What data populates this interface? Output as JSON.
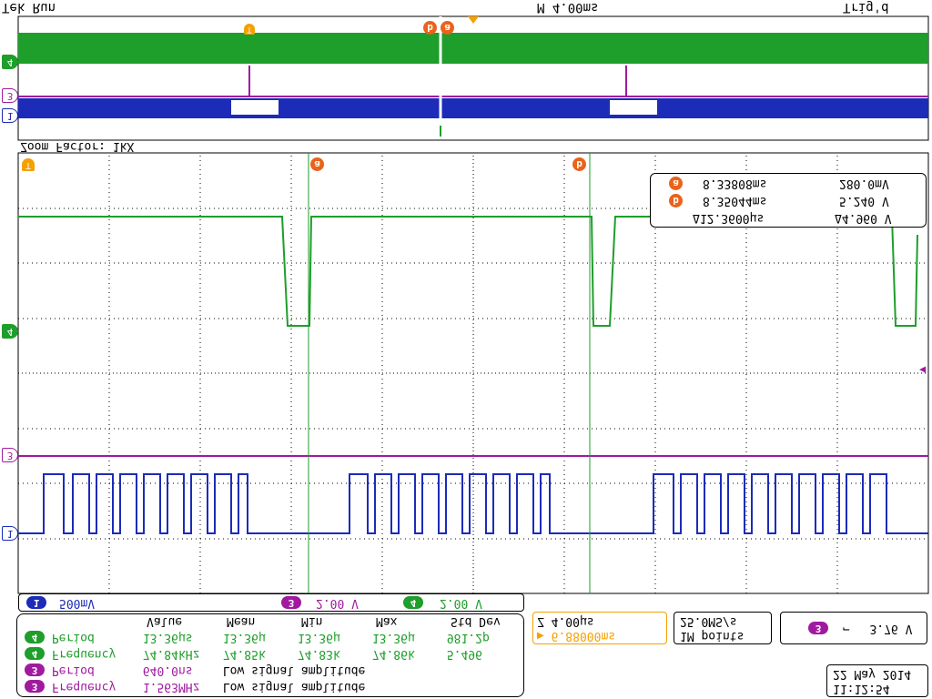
{
  "measurements": {
    "rows": [
      {
        "channel": "3",
        "name": "Frequency",
        "value": "1.563MHz",
        "mean": "Low signal amplitude",
        "min": "",
        "max": "",
        "std": ""
      },
      {
        "channel": "3",
        "name": "Period",
        "value": "640.0ns",
        "mean": "Low signal amplitude",
        "min": "",
        "max": "",
        "std": ""
      },
      {
        "channel": "4",
        "name": "Frequency",
        "value": "74.84kHz",
        "mean": "74.85k",
        "min": "74.83k",
        "max": "74.86k",
        "std": "5.496"
      },
      {
        "channel": "4",
        "name": "Period",
        "value": "13.36μs",
        "mean": "13.36μ",
        "min": "13.36μ",
        "max": "13.36μ",
        "std": "981.2p"
      }
    ],
    "headers": {
      "value": "Value",
      "mean": "Mean",
      "min": "Min",
      "max": "Max",
      "std": "Std Dev"
    }
  },
  "clock": {
    "time": "11:12:54",
    "date": "22 May 2014"
  },
  "timebase": {
    "delay": "▶ 6.88000ms",
    "scale": "Z 4.00μs"
  },
  "acquisition": {
    "points": "1M points",
    "rate": "25.0MS/s"
  },
  "trigger_info": {
    "channel": "3",
    "slope": "⌐",
    "level": "3.76 V"
  },
  "channels": [
    {
      "id": "1",
      "scale": "500mV",
      "color": "#1c2bb8"
    },
    {
      "id": "3",
      "scale": "2.00 V",
      "color": "#a01aa0"
    },
    {
      "id": "4",
      "scale": "2.00 V",
      "color": "#1e9e2a"
    }
  ],
  "cursors": {
    "delta_time": "Δ12.3600μs",
    "delta_volt": "Δ4.960 V",
    "a_label": "a",
    "a_time": "8.33808ms",
    "a_volt": "280.0mV",
    "b_label": "b",
    "b_time": "8.35044ms",
    "b_volt": "5.240 V"
  },
  "zoom": {
    "factor": "Zoom Factor: 1kX"
  },
  "status": {
    "run": "Tek Run",
    "horiz": "M 4.00ms",
    "trig": "Trig'd"
  },
  "markers": {
    "trigger": "T",
    "ch1": "1",
    "ch3": "3",
    "ch4": "4"
  }
}
